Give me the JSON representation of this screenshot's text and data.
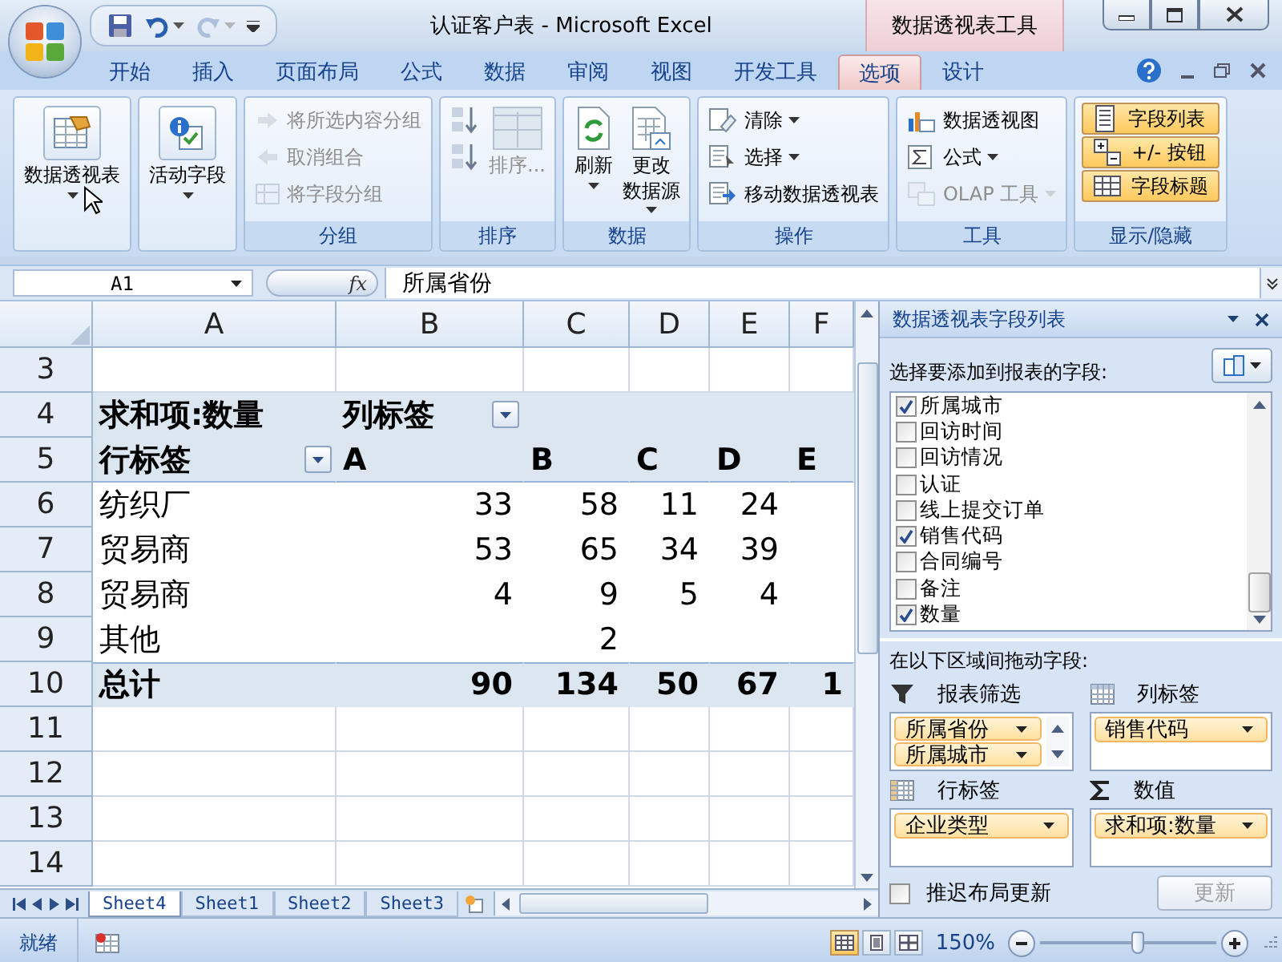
{
  "window": {
    "title": "认证客户表 - Microsoft Excel",
    "context_title": "数据透视表工具"
  },
  "tabs": [
    {
      "label": "开始",
      "selected": false
    },
    {
      "label": "插入",
      "selected": false
    },
    {
      "label": "页面布局",
      "selected": false
    },
    {
      "label": "公式",
      "selected": false
    },
    {
      "label": "数据",
      "selected": false
    },
    {
      "label": "审阅",
      "selected": false
    },
    {
      "label": "视图",
      "selected": false
    },
    {
      "label": "开发工具",
      "selected": false
    },
    {
      "label": "选项",
      "selected": true
    },
    {
      "label": "设计",
      "selected": false
    }
  ],
  "ribbon": {
    "groups": [
      {
        "items": [
          {
            "kind": "large",
            "label": "数据透视表",
            "dropdown": true,
            "disabled": false
          }
        ]
      },
      {
        "items": [
          {
            "kind": "large",
            "label": "活动字段",
            "dropdown": true,
            "disabled": false
          }
        ]
      },
      {
        "label": "分组",
        "items": [
          {
            "kind": "small",
            "label": "将所选内容分组",
            "dropdown": false,
            "disabled": true
          },
          {
            "kind": "small",
            "label": "取消组合",
            "dropdown": false,
            "disabled": true
          },
          {
            "kind": "small",
            "label": "将字段分组",
            "dropdown": false,
            "disabled": true
          }
        ]
      },
      {
        "label": "排序",
        "items": [
          {
            "kind": "icon",
            "dropdown": false,
            "disabled": false
          },
          {
            "kind": "icon",
            "dropdown": false,
            "disabled": false
          },
          {
            "kind": "large",
            "label": "排序...",
            "dropdown": false,
            "disabled": true
          }
        ]
      },
      {
        "label": "数据",
        "items": [
          {
            "kind": "large",
            "label": "刷新",
            "dropdown": true,
            "disabled": false
          },
          {
            "kind": "large",
            "label": "更改",
            "label_2": "数据源",
            "dropdown": true,
            "disabled": false
          }
        ]
      },
      {
        "label": "操作",
        "items": [
          {
            "kind": "small",
            "label": "清除",
            "dropdown": true,
            "disabled": false
          },
          {
            "kind": "small",
            "label": "选择",
            "dropdown": true,
            "disabled": false
          },
          {
            "kind": "small",
            "label": "移动数据透视表",
            "dropdown": false,
            "disabled": false
          }
        ]
      },
      {
        "label": "工具",
        "items": [
          {
            "kind": "small",
            "label": "数据透视图",
            "dropdown": false,
            "disabled": false
          },
          {
            "kind": "small",
            "label": "公式",
            "dropdown": true,
            "disabled": false
          },
          {
            "kind": "small",
            "label": "OLAP 工具",
            "dropdown": true,
            "disabled": true
          }
        ]
      },
      {
        "label": "显示/隐藏",
        "items": [
          {
            "kind": "toggle",
            "label": "字段列表",
            "dropdown": false,
            "disabled": false,
            "on": true
          },
          {
            "kind": "toggle",
            "label": "+/- 按钮",
            "dropdown": false,
            "disabled": false,
            "on": true
          },
          {
            "kind": "toggle",
            "label": "字段标题",
            "dropdown": false,
            "disabled": false,
            "on": true
          }
        ]
      }
    ]
  },
  "formula_bar": {
    "name_box": "A1",
    "function_button": "fx",
    "formula": "所属省份"
  },
  "sheet": {
    "columns": [
      "A",
      "B",
      "C",
      "D",
      "E",
      "F"
    ],
    "rows": [
      {
        "number": "3",
        "kind": "blank"
      },
      {
        "number": "4",
        "kind": "pivot_header",
        "cells": [
          {
            "kind": "text",
            "text": "求和项:数量",
            "dropdown": false
          },
          {
            "kind": "text",
            "text": "列标签",
            "dropdown": true
          },
          {
            "kind": "empty"
          },
          {
            "kind": "empty"
          },
          {
            "kind": "empty"
          },
          {
            "kind": "empty"
          }
        ]
      },
      {
        "number": "5",
        "kind": "pivot_header",
        "cells": [
          {
            "kind": "text",
            "text": "行标签",
            "dropdown": true
          },
          {
            "kind": "text",
            "text": "A",
            "dropdown": false
          },
          {
            "kind": "text",
            "text": "B",
            "dropdown": false
          },
          {
            "kind": "text",
            "text": "C",
            "dropdown": false
          },
          {
            "kind": "text",
            "text": "D",
            "dropdown": false
          },
          {
            "kind": "text",
            "text": "E",
            "dropdown": false
          }
        ]
      },
      {
        "number": "6",
        "kind": "data",
        "cells": [
          {
            "kind": "text",
            "text": "纺织厂",
            "dropdown": false
          },
          {
            "kind": "text",
            "text": "33",
            "dropdown": false
          },
          {
            "kind": "text",
            "text": "58",
            "dropdown": false
          },
          {
            "kind": "text",
            "text": "11",
            "dropdown": false
          },
          {
            "kind": "text",
            "text": "24",
            "dropdown": false
          },
          {
            "kind": "empty"
          }
        ]
      },
      {
        "number": "7",
        "kind": "data",
        "cells": [
          {
            "kind": "text",
            "text": "贸易商",
            "dropdown": false
          },
          {
            "kind": "text",
            "text": "53",
            "dropdown": false
          },
          {
            "kind": "text",
            "text": "65",
            "dropdown": false
          },
          {
            "kind": "text",
            "text": "34",
            "dropdown": false
          },
          {
            "kind": "text",
            "text": "39",
            "dropdown": false
          },
          {
            "kind": "empty"
          }
        ]
      },
      {
        "number": "8",
        "kind": "data",
        "cells": [
          {
            "kind": "text",
            "text": "贸易商",
            "dropdown": false
          },
          {
            "kind": "text",
            "text": "4",
            "dropdown": false
          },
          {
            "kind": "text",
            "text": "9",
            "dropdown": false
          },
          {
            "kind": "text",
            "text": "5",
            "dropdown": false
          },
          {
            "kind": "text",
            "text": "4",
            "dropdown": false
          },
          {
            "kind": "empty"
          }
        ]
      },
      {
        "number": "9",
        "kind": "data",
        "cells": [
          {
            "kind": "text",
            "text": "其他",
            "dropdown": false
          },
          {
            "kind": "empty"
          },
          {
            "kind": "text",
            "text": "2",
            "dropdown": false
          },
          {
            "kind": "empty"
          },
          {
            "kind": "empty"
          },
          {
            "kind": "empty"
          }
        ]
      },
      {
        "number": "10",
        "kind": "total",
        "cells": [
          {
            "kind": "text",
            "text": "总计",
            "dropdown": false
          },
          {
            "kind": "text",
            "text": "90",
            "dropdown": false
          },
          {
            "kind": "text",
            "text": "134",
            "dropdown": false
          },
          {
            "kind": "text",
            "text": "50",
            "dropdown": false
          },
          {
            "kind": "text",
            "text": "67",
            "dropdown": false
          },
          {
            "kind": "text",
            "text": "1",
            "dropdown": false
          }
        ]
      },
      {
        "number": "11",
        "kind": "blank"
      },
      {
        "number": "12",
        "kind": "blank"
      },
      {
        "number": "13",
        "kind": "blank"
      },
      {
        "number": "14",
        "kind": "blank"
      }
    ]
  },
  "sheet_tabs": [
    {
      "label": "Sheet4",
      "selected": true
    },
    {
      "label": "Sheet1",
      "selected": false
    },
    {
      "label": "Sheet2",
      "selected": false
    },
    {
      "label": "Sheet3",
      "selected": false
    }
  ],
  "field_list": {
    "title": "数据透视表字段列表",
    "prompt": "选择要添加到报表的字段:",
    "fields": [
      {
        "label": "所属城市",
        "checked": true
      },
      {
        "label": "回访时间",
        "checked": false
      },
      {
        "label": "回访情况",
        "checked": false
      },
      {
        "label": "认证",
        "checked": false
      },
      {
        "label": "线上提交订单",
        "checked": false
      },
      {
        "label": "销售代码",
        "checked": true
      },
      {
        "label": "合同编号",
        "checked": false
      },
      {
        "label": "备注",
        "checked": false
      },
      {
        "label": "数量",
        "checked": true
      }
    ],
    "drag_prompt": "在以下区域间拖动字段:",
    "areas": [
      {
        "kind": "filter",
        "label": "报表筛选",
        "items": [
          "所属省份",
          "所属城市"
        ]
      },
      {
        "kind": "column",
        "label": "列标签",
        "items": [
          "销售代码"
        ]
      },
      {
        "kind": "row",
        "label": "行标签",
        "items": [
          "企业类型"
        ]
      },
      {
        "kind": "value",
        "label": "数值",
        "items": [
          "求和项:数量"
        ]
      }
    ],
    "defer_update": {
      "label": "推迟布局更新",
      "checked": false
    },
    "update_button": {
      "label": "更新",
      "disabled": true
    }
  },
  "status_bar": {
    "status": "就绪",
    "views": [
      {
        "selected": true
      },
      {
        "selected": false
      },
      {
        "selected": false
      }
    ],
    "zoom": "150%",
    "zoom_slider": {
      "level": 0.55
    }
  }
}
